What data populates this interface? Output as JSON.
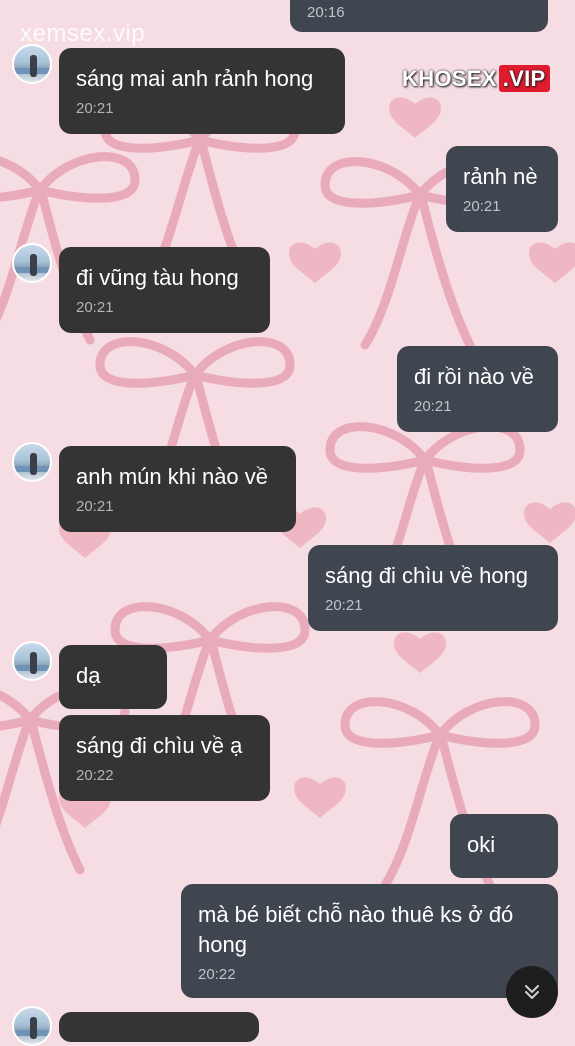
{
  "watermarks": {
    "top_left": "xemsex.vip",
    "top_right_main": "KHOSEX",
    "top_right_suffix": ".VIP"
  },
  "colors": {
    "background": "#f6dde3",
    "bow": "#e9aabb",
    "incoming_bubble": "#343434",
    "outgoing_bubble": "#3f4650"
  },
  "messages": [
    {
      "dir": "out",
      "text": "",
      "time": "20:16"
    },
    {
      "dir": "in",
      "text": "sáng mai anh rảnh hong",
      "time": "20:21"
    },
    {
      "dir": "out",
      "text": "rảnh nè",
      "time": "20:21"
    },
    {
      "dir": "in",
      "text": "đi vũng tàu hong",
      "time": "20:21"
    },
    {
      "dir": "out",
      "text": "đi rồi nào về",
      "time": "20:21"
    },
    {
      "dir": "in",
      "text": "anh mún khi nào về",
      "time": "20:21"
    },
    {
      "dir": "out",
      "text": "sáng đi chìu về hong",
      "time": "20:21"
    },
    {
      "dir": "in",
      "text": "dạ",
      "time": ""
    },
    {
      "dir": "in",
      "text": "sáng đi chìu về ạ",
      "time": "20:22"
    },
    {
      "dir": "out",
      "text": "oki",
      "time": ""
    },
    {
      "dir": "out",
      "text": "mà bé biết chỗ nào thuê ks ở đó hong",
      "time": "20:22"
    }
  ],
  "scroll_button": {
    "icon": "double-chevron-down-icon"
  }
}
